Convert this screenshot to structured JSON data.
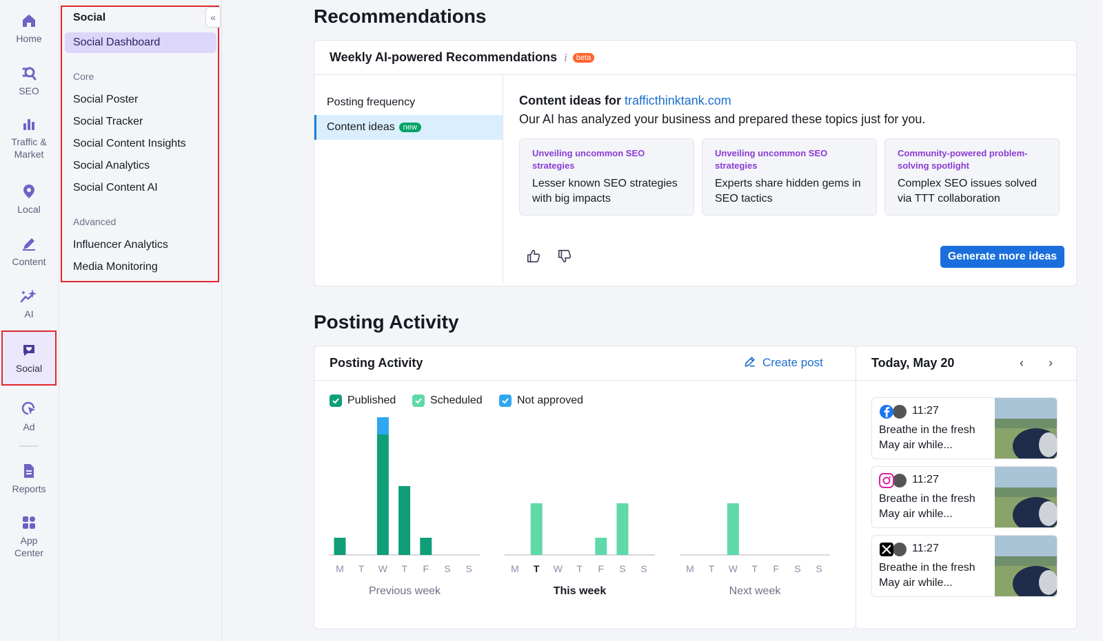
{
  "rail": {
    "items": [
      {
        "label": "Home",
        "icon": "home-icon"
      },
      {
        "label": "SEO",
        "icon": "seo-icon"
      },
      {
        "label": "Traffic &\nMarket",
        "icon": "bar-chart-icon"
      },
      {
        "label": "Local",
        "icon": "location-pin-icon"
      },
      {
        "label": "Content",
        "icon": "pen-icon"
      },
      {
        "label": "AI",
        "icon": "sparkle-icon"
      },
      {
        "label": "Social",
        "icon": "heart-chat-icon"
      },
      {
        "label": "Ad",
        "icon": "cursor-target-icon"
      },
      {
        "label": "Reports",
        "icon": "document-icon"
      },
      {
        "label": "App\nCenter",
        "icon": "grid-icon"
      }
    ]
  },
  "subnav": {
    "title": "Social",
    "dashboard": "Social Dashboard",
    "core_label": "Core",
    "core": [
      "Social Poster",
      "Social Tracker",
      "Social Content Insights",
      "Social Analytics",
      "Social Content AI"
    ],
    "advanced_label": "Advanced",
    "advanced": [
      "Influencer Analytics",
      "Media Monitoring"
    ]
  },
  "recommendations": {
    "heading": "Recommendations",
    "card_title": "Weekly AI-powered Recommendations",
    "info": "i",
    "beta": "beta",
    "tabs": [
      {
        "label": "Posting frequency",
        "badge": ""
      },
      {
        "label": "Content ideas",
        "badge": "new"
      }
    ],
    "content_title": "Content ideas for",
    "domain": "trafficthinktank.com",
    "subtitle": "Our AI has analyzed your business and prepared these topics just for you.",
    "ideas": [
      {
        "title": "Unveiling uncommon SEO strategies",
        "desc": "Lesser known SEO strategies with big impacts"
      },
      {
        "title": "Unveiling uncommon SEO strategies",
        "desc": "Experts share hidden gems in SEO tactics"
      },
      {
        "title": "Community-powered problem-solving spotlight",
        "desc": "Complex SEO issues solved via TTT collaboration"
      }
    ],
    "generate_button": "Generate more ideas"
  },
  "posting": {
    "heading": "Posting Activity",
    "card_title": "Posting Activity",
    "create_post": "Create post",
    "legend": [
      {
        "label": "Published",
        "color": "#0f9e78"
      },
      {
        "label": "Scheduled",
        "color": "#5fd9a8"
      },
      {
        "label": "Not approved",
        "color": "#2fa7f0"
      }
    ],
    "weekday_letters": [
      "M",
      "T",
      "W",
      "T",
      "F",
      "S",
      "S"
    ],
    "week_labels": [
      "Previous week",
      "This week",
      "Next week"
    ]
  },
  "chart_data": {
    "type": "bar",
    "title": "",
    "categories": [
      "M",
      "T",
      "W",
      "T",
      "F",
      "S",
      "S"
    ],
    "groups": [
      {
        "name": "Previous week",
        "published": [
          1,
          0,
          7,
          4,
          1,
          0,
          0
        ],
        "scheduled": [
          0,
          0,
          0,
          0,
          0,
          0,
          0
        ],
        "not_approved": [
          0,
          0,
          1,
          0,
          0,
          0,
          0
        ]
      },
      {
        "name": "This week",
        "published": [
          0,
          0,
          0,
          0,
          0,
          0,
          0
        ],
        "scheduled": [
          0,
          3,
          0,
          0,
          1,
          3,
          0
        ],
        "not_approved": [
          0,
          0,
          0,
          0,
          0,
          0,
          0
        ]
      },
      {
        "name": "Next week",
        "published": [
          0,
          0,
          0,
          0,
          0,
          0,
          0
        ],
        "scheduled": [
          0,
          0,
          3,
          0,
          0,
          0,
          0
        ],
        "not_approved": [
          0,
          0,
          0,
          0,
          0,
          0,
          0
        ]
      }
    ],
    "highlight_day": {
      "group": 1,
      "index": 1
    },
    "ylim": [
      0,
      8
    ]
  },
  "day_panel": {
    "title": "Today, May 20",
    "posts": [
      {
        "time": "11:27",
        "text": "Breathe in the fresh May air while...",
        "network": "facebook-icon"
      },
      {
        "time": "11:27",
        "text": "Breathe in the fresh May air while...",
        "network": "instagram-icon"
      },
      {
        "time": "11:27",
        "text": "Breathe in the fresh May air while...",
        "network": "x-icon"
      }
    ]
  }
}
